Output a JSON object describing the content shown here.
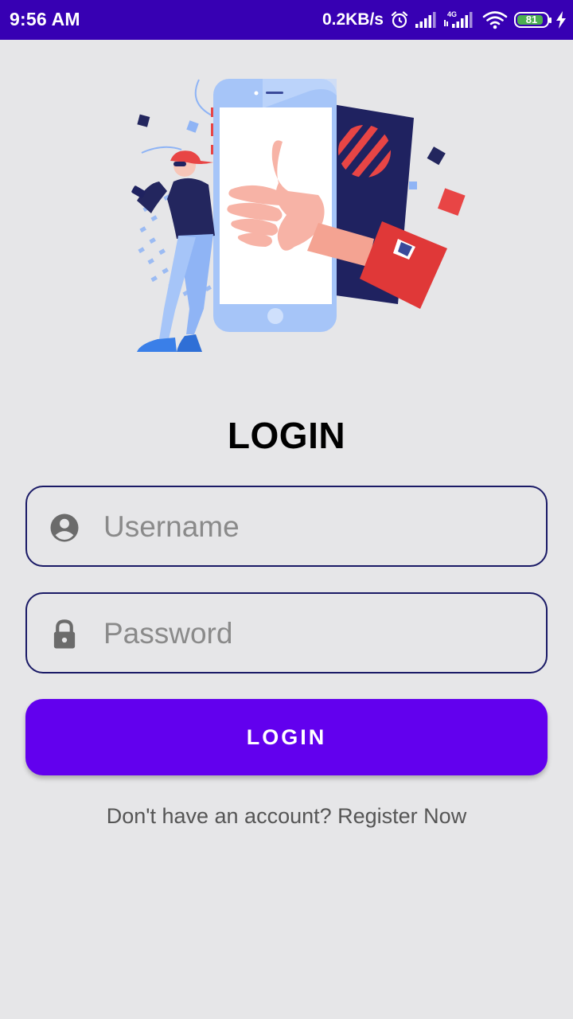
{
  "status_bar": {
    "time": "9:56 AM",
    "net_speed": "0.2KB/s",
    "network_type": "4G",
    "battery_level": "81",
    "icons": [
      "alarm-icon",
      "signal-icon",
      "signal-4g-icon",
      "wifi-icon",
      "battery-icon",
      "charging-icon"
    ]
  },
  "hero": {
    "icon": "login-illustration"
  },
  "login": {
    "title": "LOGIN",
    "username": {
      "placeholder": "Username",
      "value": "",
      "icon": "account-circle-icon"
    },
    "password": {
      "placeholder": "Password",
      "value": "",
      "icon": "lock-icon"
    },
    "button_label": "LOGIN",
    "register_text": "Don't have an account? Register Now"
  },
  "colors": {
    "status_bar": "#3700b3",
    "primary": "#6200ee",
    "field_border": "#1a1a66",
    "background": "#e6e6e8"
  }
}
